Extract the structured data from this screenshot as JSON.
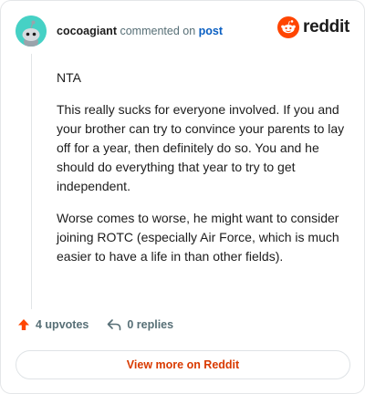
{
  "header": {
    "username": "cocoagiant",
    "commented_on": "commented on",
    "post_link": "post"
  },
  "brand": {
    "name": "reddit",
    "color": "#ff4500"
  },
  "comment": {
    "paragraphs": [
      "NTA",
      "This really sucks for everyone involved. If you and your brother can try to convince your parents to lay off for a year, then definitely do so. You and he should do everything that year to try to get independent.",
      "Worse comes to worse, he might want to consider joining ROTC (especially Air Force, which is much easier to have a life in than other fields)."
    ]
  },
  "actions": {
    "upvotes": "4 upvotes",
    "replies": "0 replies"
  },
  "footer": {
    "view_more": "View more on Reddit"
  },
  "icons": {
    "upvote": "upvote-arrow-icon",
    "reply": "reply-arrow-icon",
    "logo": "reddit-snoo-icon",
    "avatar": "snoo-avatar-icon"
  }
}
